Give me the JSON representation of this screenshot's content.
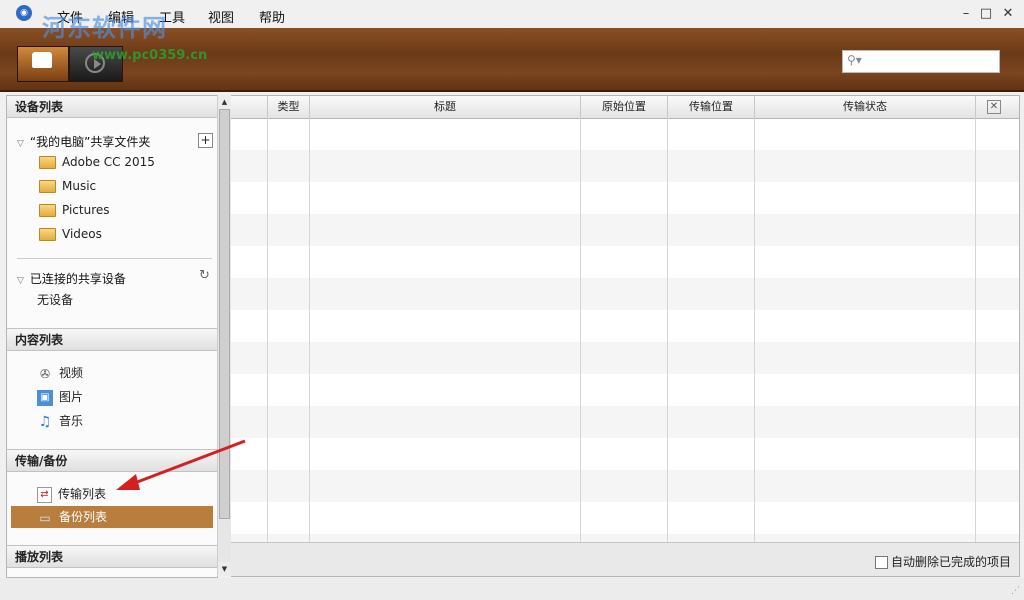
{
  "menubar": {
    "items": [
      "文件",
      "编辑",
      "工具",
      "视图",
      "帮助"
    ],
    "controls": [
      "–",
      "□",
      "✕"
    ]
  },
  "watermark": {
    "title": "河东软件网",
    "url": "www.pc0359.cn"
  },
  "search": {
    "placeholder": ""
  },
  "left_panel": {
    "devices": {
      "header": "设备列表",
      "my_pc_share": "“我的电脑”共享文件夹",
      "folders": [
        "Adobe CC 2015",
        "Music",
        "Pictures",
        "Videos"
      ],
      "connected_title": "已连接的共享设备",
      "no_device": "无设备"
    },
    "content": {
      "header": "内容列表",
      "items": [
        "视频",
        "图片",
        "音乐"
      ]
    },
    "transfer": {
      "header": "传输/备份",
      "items": [
        "传输列表",
        "备份列表"
      ],
      "selected": "备份列表"
    },
    "playlist": {
      "header": "播放列表"
    }
  },
  "table": {
    "columns": [
      "",
      "类型",
      "标题",
      "原始位置",
      "传输位置",
      "传输状态"
    ],
    "rows": []
  },
  "footer": {
    "auto_delete_label": "自动删除已完成的项目",
    "auto_delete_checked": false
  },
  "colors": {
    "wood": "#6b3a17",
    "selection": "#b97e3d",
    "annotation_arrow": "#d42020"
  }
}
